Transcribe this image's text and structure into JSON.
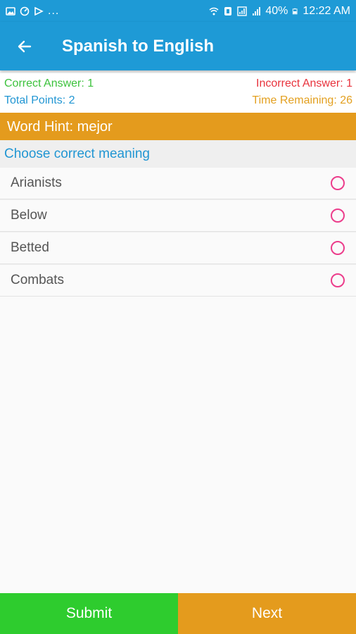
{
  "status_bar": {
    "dots": "...",
    "battery_percent": "40%",
    "time": "12:22 AM"
  },
  "app_bar": {
    "title": "Spanish to English",
    "back_icon": "arrow-left-icon"
  },
  "score": {
    "correct_answer": "Correct Answer: 1",
    "incorrect_answer": "Incorrect Answer: 1",
    "total_points": "Total Points: 2",
    "time_remaining": "Time Remaining: 26"
  },
  "hint": {
    "text": "Word Hint: mejor"
  },
  "question": {
    "prompt": "Choose correct meaning"
  },
  "options": [
    {
      "label": "Arianists",
      "selected": false
    },
    {
      "label": "Below",
      "selected": false
    },
    {
      "label": "Betted",
      "selected": false
    },
    {
      "label": "Combats",
      "selected": false
    }
  ],
  "buttons": {
    "submit": "Submit",
    "next": "Next"
  },
  "colors": {
    "primary": "#1e9ad6",
    "hint_orange": "#e49b1d",
    "submit_green": "#2ecc2e",
    "radio_pink": "#ec3d8b",
    "correct_green": "#3cc23c",
    "incorrect_red": "#e8323c"
  }
}
